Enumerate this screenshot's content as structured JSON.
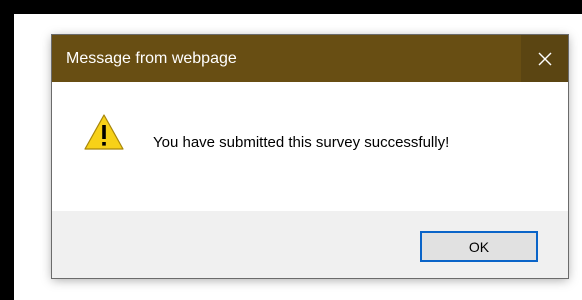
{
  "dialog": {
    "title": "Message from webpage",
    "close_icon": "close-icon",
    "message": "You have submitted this survey successfully!",
    "warning_icon": "warning-icon",
    "ok_label": "OK"
  },
  "colors": {
    "titlebar": "#684e13",
    "close_button_bg": "#5b4512",
    "footer_bg": "#f0f0f0",
    "ok_border": "#0a64c8",
    "warning_yellow": "#f7d118"
  }
}
